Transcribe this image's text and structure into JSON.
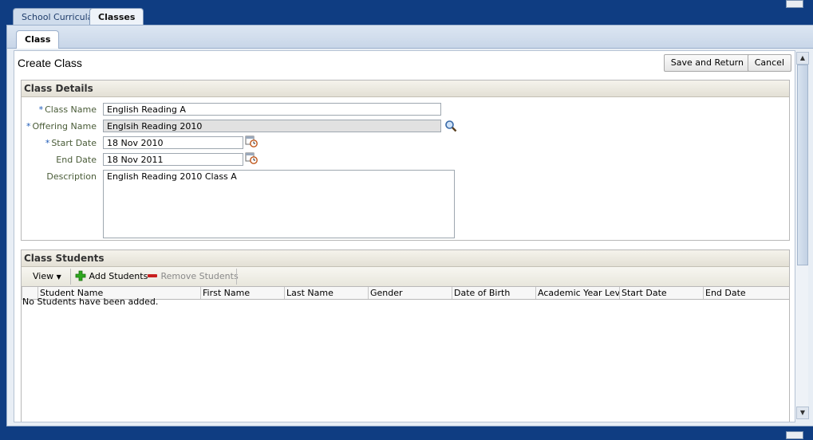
{
  "top_tabs": [
    "School Curricula",
    "Classes"
  ],
  "sub_tab": "Class",
  "page": {
    "title": "Create Class",
    "save_label": "Save and Return",
    "cancel_label": "Cancel"
  },
  "details": {
    "header": "Class Details",
    "required_marker": "*",
    "class_name_label": "Class Name",
    "class_name_value": "English Reading A",
    "offering_name_label": "Offering Name",
    "offering_name_value": "Englsih Reading 2010",
    "start_date_label": "Start Date",
    "start_date_value": "18 Nov 2010",
    "end_date_label": "End Date",
    "end_date_value": "18 Nov 2011",
    "description_label": "Description",
    "description_value": "English Reading 2010 Class A"
  },
  "students": {
    "header": "Class Students",
    "view_label": "View",
    "add_label": "Add Students",
    "remove_label": "Remove Students",
    "columns": [
      "Student Name",
      "First Name",
      "Last Name",
      "Gender",
      "Date of Birth",
      "Academic Year Level",
      "Start Date",
      "End Date"
    ],
    "empty_message": "No Students have been added."
  },
  "icons": {
    "search": "magnifier-icon",
    "calendar": "calendar-icon",
    "add": "plus-icon",
    "remove": "minus-icon"
  }
}
